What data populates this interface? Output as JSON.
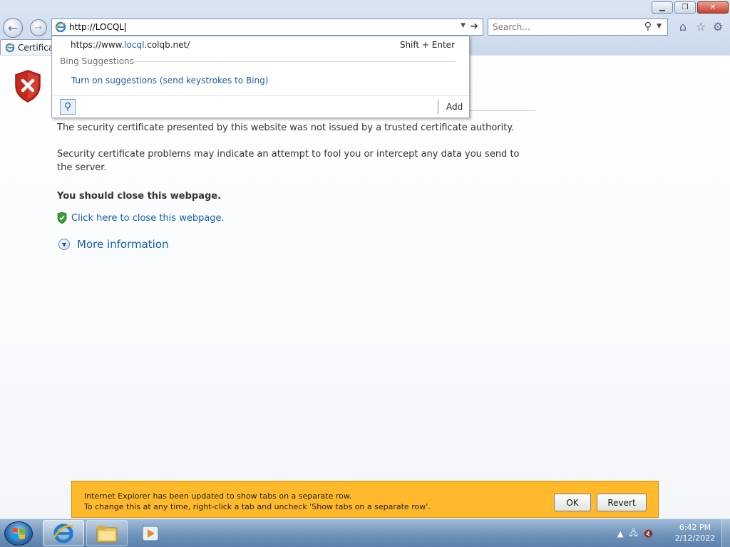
{
  "browser": {
    "address_value": "http://LOCQL",
    "search_placeholder": "Search...",
    "tab_title": "Certifica",
    "buttons": {
      "back": "back-arrow",
      "forward": "forward-arrow",
      "go": "go-arrow"
    },
    "window_controls": [
      "minimize",
      "restore",
      "close"
    ],
    "toolbar_icons": [
      "home-icon",
      "favorites-star-icon",
      "tools-gear-icon"
    ]
  },
  "autocomplete": {
    "url_prefix": "https://www.",
    "url_highlight": "locql",
    "url_suffix": ".colqb.net/",
    "shortcut": "Shift + Enter",
    "section_label": "Bing Suggestions",
    "suggestion_link": "Turn on suggestions (send keystrokes to Bing)",
    "add_label": "Add"
  },
  "page": {
    "paragraph1": "The security certificate presented by this website was not issued by a trusted certificate authority.",
    "paragraph2": "Security certificate problems may indicate an attempt to fool you or intercept any data you send to the server.",
    "warning": "You should close this webpage.",
    "close_link": "Click here to close this webpage.",
    "more_info": "More information"
  },
  "notification": {
    "line1": "Internet Explorer has been updated to show tabs on a separate row.",
    "line2": "To change this at any time, right-click a tab and uncheck 'Show tabs on a separate row'.",
    "ok_label": "OK",
    "revert_label": "Revert",
    "bar_color": "#ffb92a"
  },
  "taskbar": {
    "items": [
      "start-button",
      "internet-explorer",
      "windows-explorer",
      "media-player"
    ],
    "time": "6:42 PM",
    "date": "2/12/2022"
  },
  "colors": {
    "link": "#1a5ea6",
    "error_shield": "#c8281e"
  }
}
